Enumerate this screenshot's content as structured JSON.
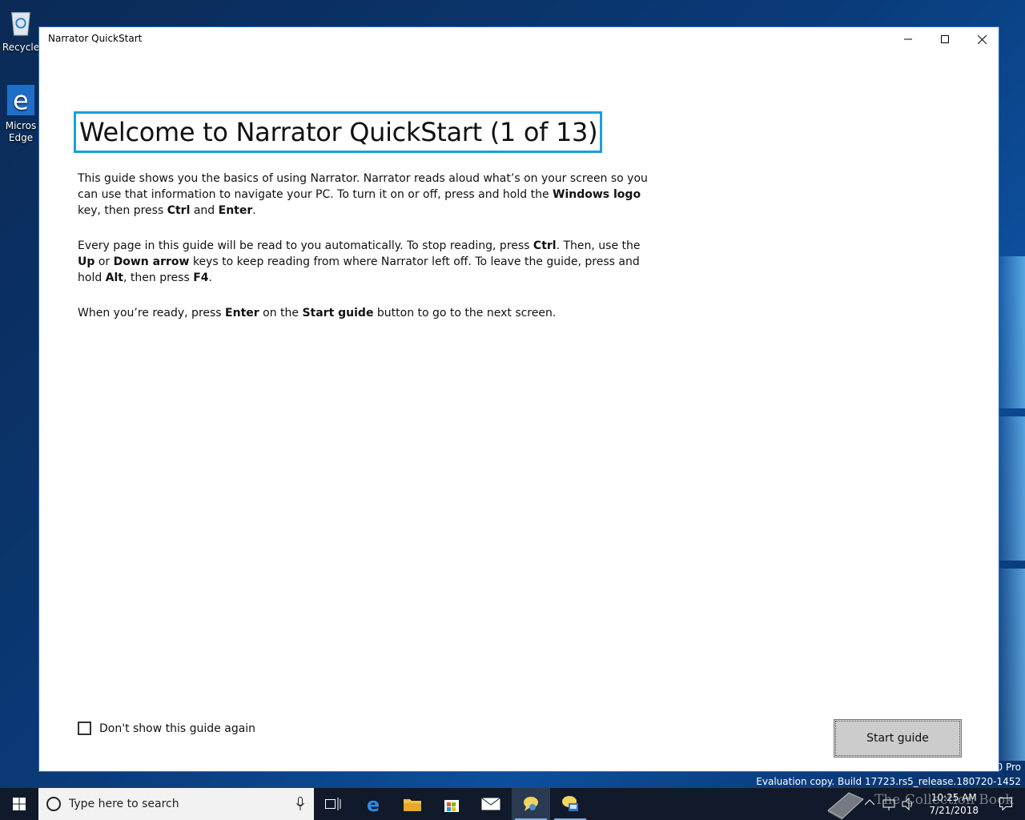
{
  "desktop": {
    "icons": [
      {
        "label": "Recycle"
      },
      {
        "label": "Micros Edge"
      }
    ],
    "watermark": {
      "edition": "0 Pro",
      "build": "Evaluation copy. Build 17723.rs5_release.180720-1452"
    },
    "overlay_brand": "The Collection Book"
  },
  "window": {
    "title": "Narrator QuickStart",
    "heading": "Welcome to Narrator QuickStart (1 of 13)",
    "paragraph1": {
      "t1": "This guide shows you the basics of using Narrator. Narrator reads aloud what’s on your screen so you can use that information to navigate your PC. To turn it on or off, press and hold the ",
      "b1": "Windows logo",
      "t2": " key, then press ",
      "b2": "Ctrl",
      "t3": " and ",
      "b3": "Enter",
      "t4": "."
    },
    "paragraph2": {
      "t1": "Every page in this guide will be read to you automatically. To stop reading, press ",
      "b1": "Ctrl",
      "t2": ". Then, use the ",
      "b2": "Up",
      "t3": " or ",
      "b3": "Down arrow",
      "t4": " keys to keep reading from where Narrator left off. To leave the guide, press and hold ",
      "b4": "Alt",
      "t5": ", then press ",
      "b5": "F4",
      "t6": "."
    },
    "paragraph3": {
      "t1": "When you’re ready, press ",
      "b1": "Enter",
      "t2": " on the ",
      "b2": "Start guide",
      "t3": " button to go to the next screen."
    },
    "checkbox_label": "Don't show this guide again",
    "checkbox_checked": false,
    "start_button": "Start guide"
  },
  "taskbar": {
    "search_placeholder": "Type here to search",
    "time": "10:25 AM",
    "date": "7/21/2018"
  },
  "colors": {
    "heading_focus": "#1a9fd9",
    "taskbar": "#101a2a",
    "button": "#cccccc"
  }
}
